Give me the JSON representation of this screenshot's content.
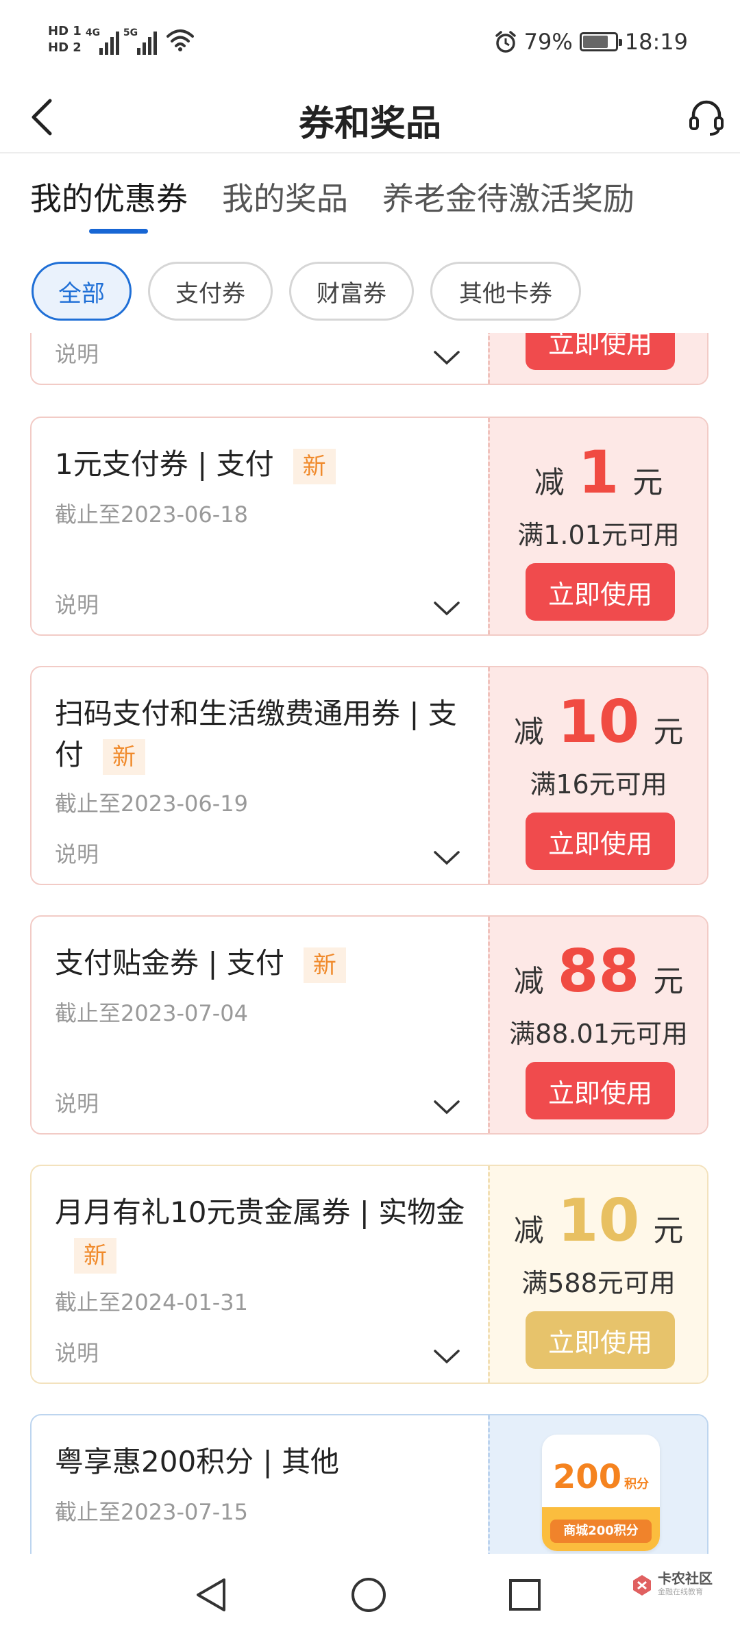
{
  "status_bar": {
    "hd1": "HD",
    "hd1_sim": "1",
    "hd2": "HD",
    "hd2_sim": "2",
    "net1": "4G",
    "net2": "5G",
    "battery_percent": "79%",
    "time": "18:19"
  },
  "header": {
    "title": "券和奖品"
  },
  "tabs": [
    {
      "label": "我的优惠券"
    },
    {
      "label": "我的奖品"
    },
    {
      "label": "养老金待激活奖励"
    }
  ],
  "filters": [
    {
      "label": "全部"
    },
    {
      "label": "支付券"
    },
    {
      "label": "财富券"
    },
    {
      "label": "其他卡券"
    }
  ],
  "partial_coupon": {
    "desc_label": "说明",
    "use_label": "立即使用"
  },
  "coupons": [
    {
      "title": "1元支付券 | 支付",
      "tag": "新",
      "expire": "截止至2023-06-18",
      "desc_label": "说明",
      "prefix": "减",
      "amount": "1",
      "unit": "元",
      "condition": "满1.01元可用",
      "use_label": "立即使用"
    },
    {
      "title": "扫码支付和生活缴费通用券 | 支付",
      "tag": "新",
      "expire": "截止至2023-06-19",
      "desc_label": "说明",
      "prefix": "减",
      "amount": "10",
      "unit": "元",
      "condition": "满16元可用",
      "use_label": "立即使用"
    },
    {
      "title": "支付贴金券 | 支付",
      "tag": "新",
      "expire": "截止至2023-07-04",
      "desc_label": "说明",
      "prefix": "减",
      "amount": "88",
      "unit": "元",
      "condition": "满88.01元可用",
      "use_label": "立即使用"
    },
    {
      "title": "月月有礼10元贵金属券 | 实物金",
      "tag": "新",
      "expire": "截止至2024-01-31",
      "desc_label": "说明",
      "prefix": "减",
      "amount": "10",
      "unit": "元",
      "condition": "满588元可用",
      "use_label": "立即使用"
    },
    {
      "title": "粤享惠200积分 | 其他",
      "expire": "截止至2023-07-15",
      "points_value": "200",
      "points_unit": "积分",
      "points_label": "商城200积分"
    }
  ],
  "watermark": {
    "main": "卡农社区",
    "sub": "金融在线教育"
  },
  "colors": {
    "accent_blue": "#1f6fd6",
    "coupon_red": "#f04b42",
    "coupon_gold": "#e8c061",
    "tag_orange": "#f08a2b"
  }
}
